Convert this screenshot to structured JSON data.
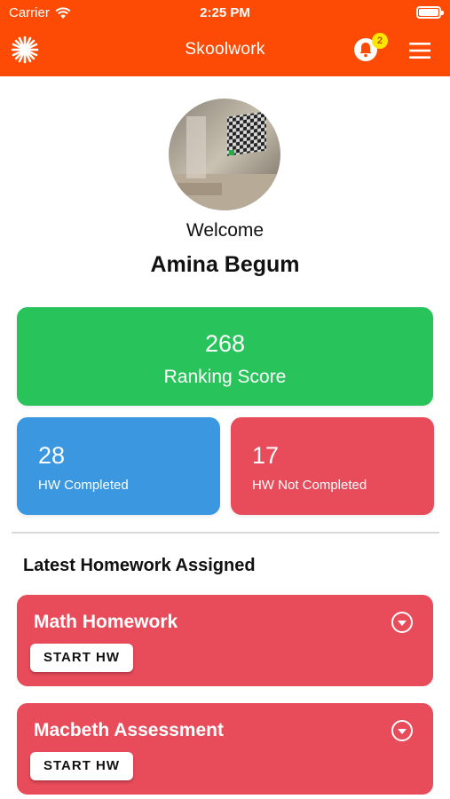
{
  "status_bar": {
    "carrier": "Carrier",
    "time": "2:25 PM"
  },
  "app_bar": {
    "title": "Skoolwork",
    "notification_count": "2"
  },
  "profile": {
    "welcome": "Welcome",
    "name": "Amina Begum"
  },
  "ranking": {
    "score": "268",
    "label": "Ranking Score"
  },
  "stats": {
    "completed": {
      "value": "28",
      "label": "HW Completed"
    },
    "not_completed": {
      "value": "17",
      "label": "HW Not Completed"
    }
  },
  "latest": {
    "title": "Latest Homework Assigned",
    "items": [
      {
        "name": "Math Homework",
        "button": "START HW"
      },
      {
        "name": "Macbeth Assessment",
        "button": "START HW"
      }
    ]
  },
  "colors": {
    "header": "#fd4a04",
    "ranking_card": "#28c35a",
    "completed_card": "#3a97e0",
    "not_completed_card": "#e84b5a",
    "badge": "#ffe600"
  }
}
